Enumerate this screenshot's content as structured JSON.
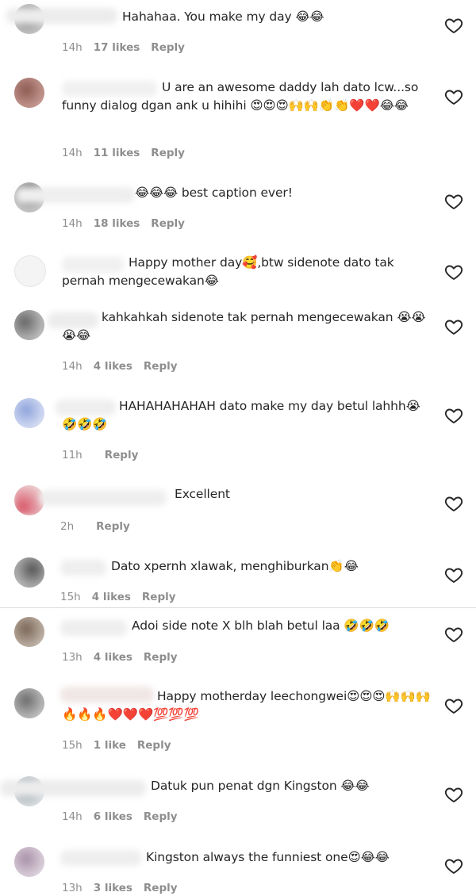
{
  "comments": [
    {
      "text": "Hahahaa. You make my day 😂😂",
      "time": "14h",
      "likes": "17 likes",
      "reply": "Reply"
    },
    {
      "text": "U are an awesome daddy lah dato lcw...so funny dialog dgan ank u hihihi 😍😍😍🙌🙌👏👏❤️❤️😂😂",
      "time": "14h",
      "likes": "11 likes",
      "reply": "Reply"
    },
    {
      "text": "😂😂😂 best caption ever!",
      "time": "14h",
      "likes": "18 likes",
      "reply": "Reply"
    },
    {
      "text": "Happy mother day🥰,btw sidenote dato tak pernah mengecewakan😂",
      "time": "",
      "likes": "",
      "reply": ""
    },
    {
      "text": "kahkahkah sidenote tak pernah mengecewakan 😭😭😭😂",
      "time": "14h",
      "likes": "4 likes",
      "reply": "Reply"
    },
    {
      "text": "HAHAHAHAHAH dato make my day betul lahhh😭🤣🤣🤣",
      "time": "11h",
      "likes": "",
      "reply": "Reply"
    },
    {
      "text": "Excellent",
      "time": "2h",
      "likes": "",
      "reply": "Reply"
    },
    {
      "text": "Dato xpernh xlawak, menghiburkan👏😂",
      "time": "15h",
      "likes": "4 likes",
      "reply": "Reply"
    },
    {
      "text": "Adoi side note X blh blah betul laa 🤣🤣🤣",
      "time": "13h",
      "likes": "4 likes",
      "reply": "Reply"
    },
    {
      "text": "Happy motherday leechongwei😍😍😍🙌🙌🙌🔥🔥🔥❤️❤️❤️💯💯💯",
      "time": "15h",
      "likes": "1 like",
      "reply": "Reply"
    },
    {
      "text": "Datuk pun penat dgn Kingston 😂😂",
      "time": "14h",
      "likes": "6 likes",
      "reply": "Reply"
    },
    {
      "text": "Kingston always the funniest one😍😂😂",
      "time": "13h",
      "likes": "3 likes",
      "reply": "Reply"
    }
  ],
  "icons": {
    "like": "heart-outline-icon",
    "avatar": "blurred-avatar"
  }
}
